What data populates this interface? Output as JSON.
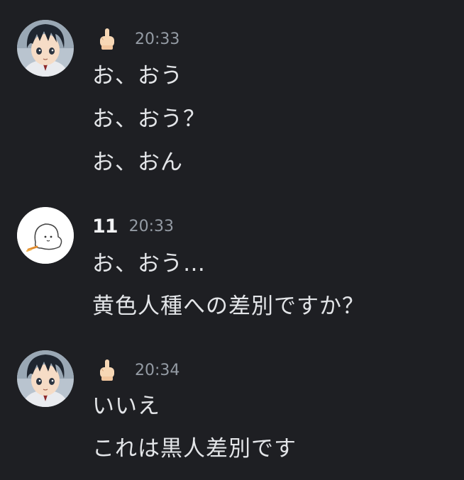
{
  "messages": [
    {
      "author_type": "emoji",
      "author_emoji": "middle-finger-emoji",
      "timestamp": "20:33",
      "lines": [
        "お、おう",
        "お、おう？",
        "お、おん"
      ]
    },
    {
      "author_type": "text",
      "author_name": "11",
      "timestamp": "20:33",
      "lines": [
        "お、おう…",
        "黄色人種への差別ですか？"
      ]
    },
    {
      "author_type": "emoji",
      "author_emoji": "middle-finger-emoji",
      "timestamp": "20:34",
      "lines": [
        "いいえ",
        "これは黒人差別です"
      ]
    }
  ],
  "colors": {
    "background": "#1e1f23",
    "text": "#e3e5e8",
    "timestamp": "#949ba4",
    "username": "#f2f3f5"
  }
}
